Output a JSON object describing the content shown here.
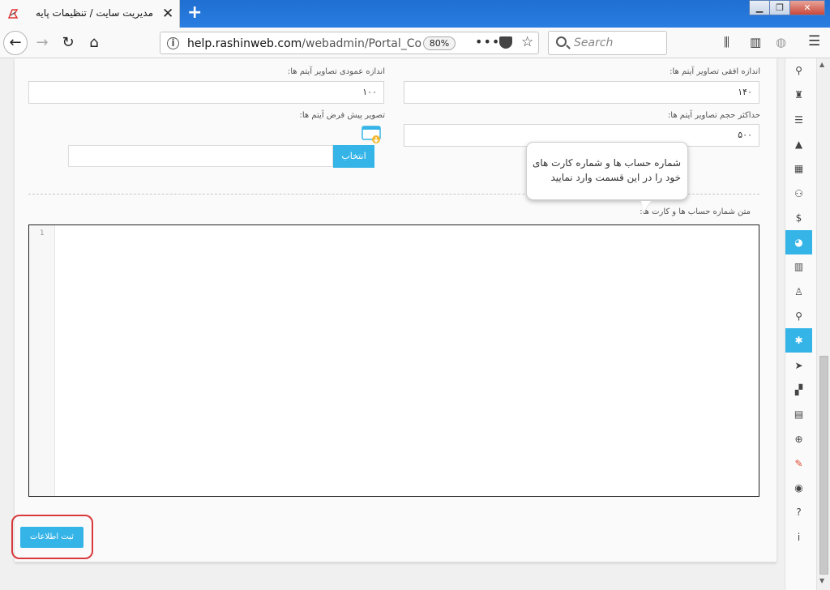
{
  "browser": {
    "tab_title": "مدیریت سایت / تنظیمات پایه",
    "url_domain": "help.rashinweb.com",
    "url_path": "/webadmin/Portal_Co",
    "zoom": "80%",
    "search_placeholder": "Search"
  },
  "form": {
    "horizontal_label": "اندازه افقی تصاویر آیتم ها:",
    "horizontal_value": "۱۴۰",
    "vertical_label": "اندازه عمودی تصاویر آیتم ها:",
    "vertical_value": "۱۰۰",
    "maxsize_label": "حداکثر حجم تصاویر آیتم ها:",
    "maxsize_value": "۵۰۰",
    "default_image_label": "تصویر پیش فرض آیتم ها:",
    "choose_label": "انتخاب",
    "accounts_label": "متن شماره حساب ها و کارت ها:",
    "editor_line": "1",
    "submit_label": "ثبت اطلاعات"
  },
  "tooltip": {
    "text": "شماره حساب ها  و شماره کارت های خود را در این قسمت وارد نمایید"
  },
  "sidebar": {
    "items": [
      {
        "icon": "sitemap-icon",
        "glyph": "⚲"
      },
      {
        "icon": "user-lock-icon",
        "glyph": "♜"
      },
      {
        "icon": "list-icon",
        "glyph": "☰"
      },
      {
        "icon": "road-icon",
        "glyph": "▲"
      },
      {
        "icon": "calendar-icon",
        "glyph": "▦"
      },
      {
        "icon": "users-icon",
        "glyph": "⚇"
      },
      {
        "icon": "dollar-icon",
        "glyph": "$"
      },
      {
        "icon": "pie-chart-icon",
        "glyph": "◕"
      },
      {
        "icon": "bar-chart-icon",
        "glyph": "▥"
      },
      {
        "icon": "stamp-icon",
        "glyph": "♙"
      },
      {
        "icon": "search-icon",
        "glyph": "⚲"
      },
      {
        "icon": "gear-icon",
        "glyph": "✱"
      },
      {
        "icon": "tags-icon",
        "glyph": "➤"
      },
      {
        "icon": "windows-icon",
        "glyph": "▞"
      },
      {
        "icon": "file-icon",
        "glyph": "▤"
      },
      {
        "icon": "zoom-icon",
        "glyph": "⊕"
      },
      {
        "icon": "wrench-icon",
        "glyph": "✎"
      },
      {
        "icon": "globe-icon",
        "glyph": "◉"
      },
      {
        "icon": "question-icon",
        "glyph": "?"
      },
      {
        "icon": "info-icon",
        "glyph": "i"
      }
    ],
    "active_indexes": [
      7,
      11
    ]
  },
  "colors": {
    "accent": "#35b4e8",
    "highlight": "#d9393c",
    "wrench": "#e0492f"
  }
}
